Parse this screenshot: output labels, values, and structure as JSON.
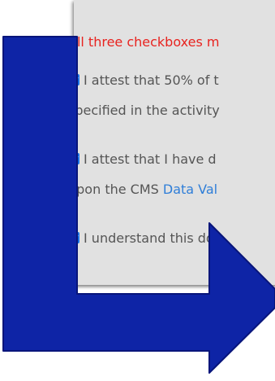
{
  "dialog": {
    "warning_text": "All three checkboxes m",
    "items": [
      {
        "checked": true,
        "line1": "I attest that 50% of t",
        "line2": "specified in the activity"
      },
      {
        "checked": true,
        "line1": "I attest that I have d",
        "line2_prefix": "upon the CMS ",
        "line2_link": "Data Val"
      },
      {
        "checked": true,
        "line1": "I understand this do"
      }
    ]
  },
  "annotation": {
    "arrow_color": "#0e24a6"
  }
}
